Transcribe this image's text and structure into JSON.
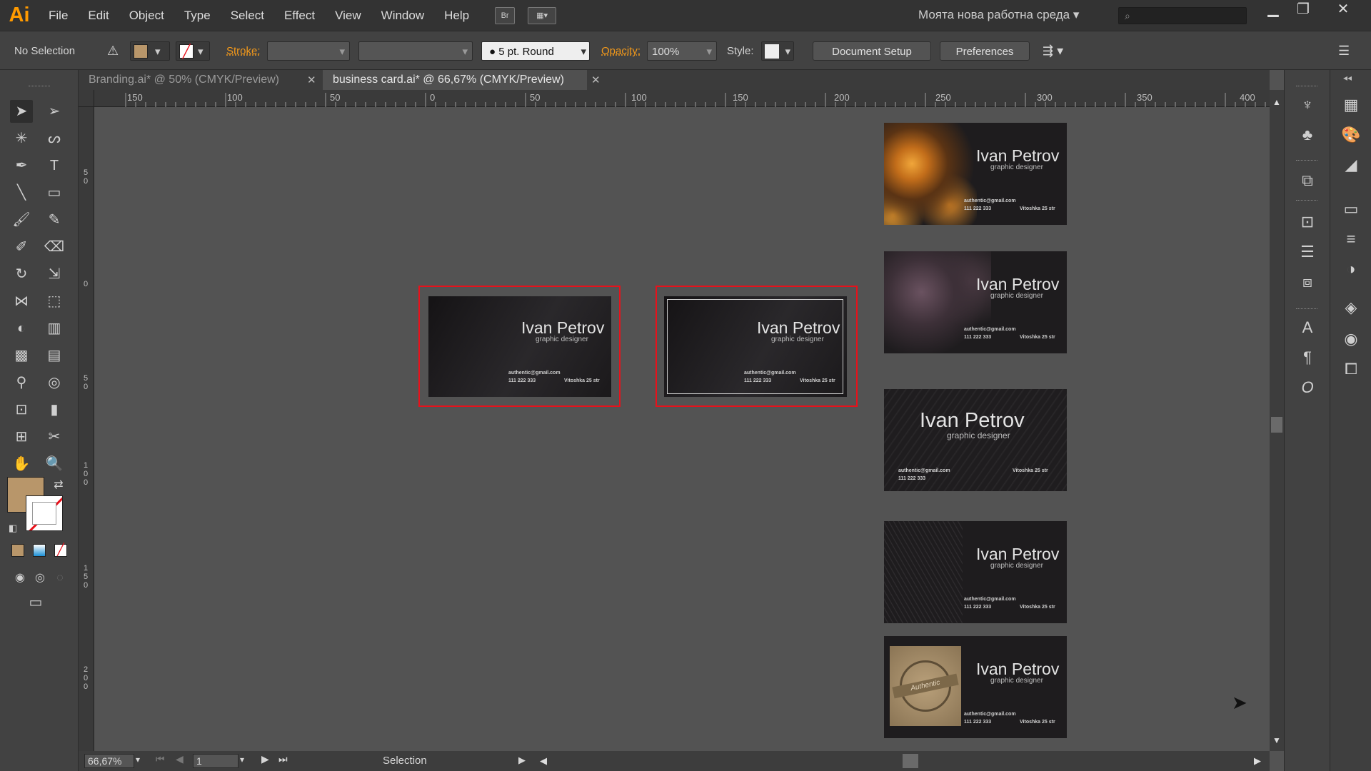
{
  "app": {
    "logo": "Ai"
  },
  "menubar": {
    "items": [
      "File",
      "Edit",
      "Object",
      "Type",
      "Select",
      "Effect",
      "View",
      "Window",
      "Help"
    ],
    "bridge_label": "Br",
    "workspace": "Моята нова работна среда",
    "search_placeholder": "",
    "window_controls": [
      "minimize",
      "restore",
      "close"
    ]
  },
  "control_bar": {
    "selection_status": "No Selection",
    "fill_color": "#b8966a",
    "stroke_label": "Stroke:",
    "brush_profile": "5 pt. Round",
    "opacity_label": "Opacity:",
    "opacity_value": "100%",
    "style_label": "Style:",
    "document_setup": "Document Setup",
    "preferences": "Preferences"
  },
  "tabs": [
    {
      "label": "Branding.ai* @ 50% (CMYK/Preview)",
      "active": false
    },
    {
      "label": "business card.ai* @ 66,67% (CMYK/Preview)",
      "active": true
    }
  ],
  "ruler": {
    "horizontal": [
      "150",
      "100",
      "50",
      "0",
      "50",
      "100",
      "150",
      "200",
      "250",
      "300",
      "350",
      "400"
    ],
    "vertical": [
      "5 0",
      "0",
      "5 0",
      "1 0 0",
      "1 5 0",
      "2 0 0"
    ]
  },
  "cards": [
    {
      "name": "Ivan Petrov",
      "role": "graphic designer",
      "email": "authentic@gmail.com",
      "phone": "111 222 333",
      "street": "Vitoshka 25 str",
      "texture": "bokeh"
    },
    {
      "name": "Ivan Petrov",
      "role": "graphic designer",
      "email": "authentic@gmail.com",
      "phone": "111 222 333",
      "street": "Vitoshka 25 str",
      "texture": "halftone"
    },
    {
      "name": "Ivan Petrov",
      "role": "graphic designer",
      "email": "authentic@gmail.com",
      "phone": "111 222 333",
      "street": "Vitoshka 25 str",
      "texture": "scratches"
    },
    {
      "name": "Ivan Petrov",
      "role": "graphic designer",
      "email": "authentic@gmail.com",
      "phone": "111 222 333",
      "street": "Vitoshka 25 str",
      "texture": "scribbles"
    },
    {
      "name": "Ivan Petrov",
      "role": "graphic designer",
      "email": "authentic@gmail.com",
      "phone": "111 222 333",
      "street": "Vitoshka 25 str",
      "texture": "stamp",
      "stamp_text": "Authentic"
    },
    {
      "name": "Ivan Petrov",
      "role": "graphic designer",
      "email": "authentic@gmail.com",
      "phone": "111 222 333",
      "street": "Vitoshka 25 str",
      "texture": "plain"
    },
    {
      "name": "Ivan Petrov",
      "role": "graphic designer",
      "email": "authentic@gmail.com",
      "phone": "111 222 333",
      "street": "Vitoshka 25 str",
      "texture": "bordered"
    }
  ],
  "status_bar": {
    "zoom": "66,67%",
    "artboard": "1",
    "tool": "Selection"
  },
  "colors": {
    "accent": "#ff9a00",
    "selection": "#e8111b",
    "fill_swatch": "#b8966a",
    "card_bg": "#1e1c1e"
  }
}
